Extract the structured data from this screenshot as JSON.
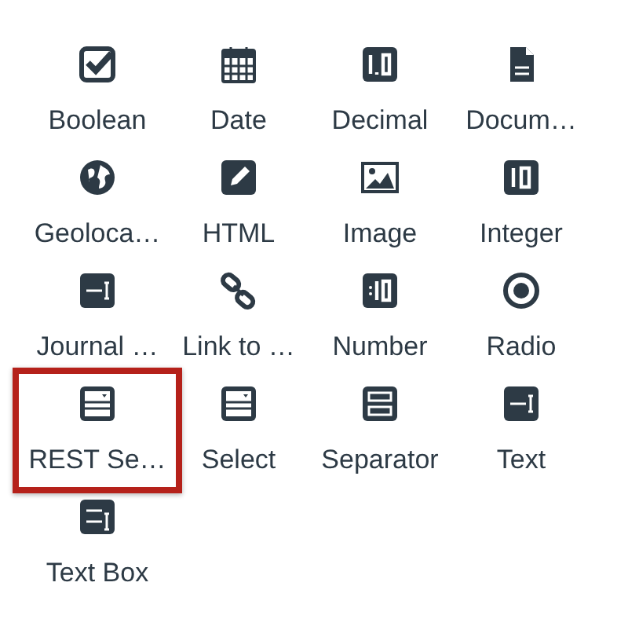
{
  "fields": [
    {
      "label": "Boolean",
      "kind": "checkbox",
      "selected": false
    },
    {
      "label": "Date",
      "kind": "calendar",
      "selected": false
    },
    {
      "label": "Decimal",
      "kind": "decimal",
      "selected": false
    },
    {
      "label": "Docum…",
      "kind": "document",
      "selected": false
    },
    {
      "label": "Geoloca…",
      "kind": "globe",
      "selected": false
    },
    {
      "label": "HTML",
      "kind": "pencil",
      "selected": false
    },
    {
      "label": "Image",
      "kind": "image",
      "selected": false
    },
    {
      "label": "Integer",
      "kind": "integer",
      "selected": false
    },
    {
      "label": "Journal …",
      "kind": "textfield",
      "selected": false
    },
    {
      "label": "Link to …",
      "kind": "link",
      "selected": false
    },
    {
      "label": "Number",
      "kind": "number",
      "selected": false
    },
    {
      "label": "Radio",
      "kind": "radio",
      "selected": false
    },
    {
      "label": "REST Se…",
      "kind": "select",
      "selected": true
    },
    {
      "label": "Select",
      "kind": "select",
      "selected": false
    },
    {
      "label": "Separator",
      "kind": "separator",
      "selected": false
    },
    {
      "label": "Text",
      "kind": "textfield",
      "selected": false
    },
    {
      "label": "Text Box",
      "kind": "textarea",
      "selected": false
    }
  ]
}
